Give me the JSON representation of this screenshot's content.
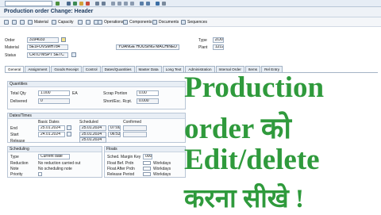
{
  "window": {
    "title": "Production order Change: Header"
  },
  "toolbar": {
    "material": "Material",
    "capacity": "Capacity",
    "operations": "Operations",
    "components": "Components",
    "documents": "Documents",
    "sequences": "Sequences"
  },
  "header": {
    "order_label": "Order",
    "order_value": "3194033",
    "type_label": "Type",
    "type_value": "ZO01",
    "material_label": "Material",
    "material_value": "5E1FOVSMH784",
    "material_desc": "YUANGE HOUSING MACHINED",
    "plant_label": "Plant",
    "plant_value": "1212",
    "status_label": "Status",
    "status_value": "CRTD MSPT SETC"
  },
  "tabs": [
    "General",
    "Assignment",
    "Goods Receipt",
    "Control",
    "Dates/Quantities",
    "Master Data",
    "Long Text",
    "Administration",
    "Internal Order",
    "Items",
    "Rel Entry"
  ],
  "quantities": {
    "title": "Quantities",
    "total_label": "Total Qty",
    "total_value": "1.000",
    "unit": "EA",
    "scrap_label": "Scrap Portion",
    "scrap_value": "0.00",
    "delivered_label": "Delivered",
    "delivered_value": "0",
    "short_label": "Short/Exc. Rcpt.",
    "short_value": "0.000"
  },
  "dates": {
    "title": "Dates/Times",
    "basic_header": "Basic Dates",
    "scheduled_header": "Scheduled",
    "confirmed_header": "Confirmed",
    "end_label": "End",
    "end_basic": "25.01.2024",
    "end_sched": "25.01.2024",
    "end_time": "07:00",
    "start_label": "Start",
    "start_basic": "24.01.2024",
    "start_sched": "25.01.2024",
    "start_time": "06:53",
    "release_label": "Release",
    "release_sched": "25.01.2024"
  },
  "scheduling": {
    "title": "Scheduling",
    "type_label": "Type",
    "type_value": "Current date",
    "reduction_label": "Reduction",
    "reduction_value": "No reduction carried out",
    "note_label": "Note",
    "note_value": "No scheduling note",
    "priority_label": "Priority"
  },
  "floats": {
    "title": "Floats",
    "margin_label": "Sched. Margin Key",
    "margin_value": "000",
    "before_label": "Float Bef. Prdn",
    "before_unit": "Workdays",
    "after_label": "Float After Prdn",
    "after_unit": "Workdays",
    "release_label": "Release Period",
    "release_unit": "Workdays"
  },
  "overlay": {
    "line1": "Production",
    "line2": "order को",
    "line3": "Edit/delete",
    "line4": "करना सीखे !"
  },
  "colors": {
    "overlay_text": "#2f9a3c",
    "title_text": "#1f3c60"
  }
}
